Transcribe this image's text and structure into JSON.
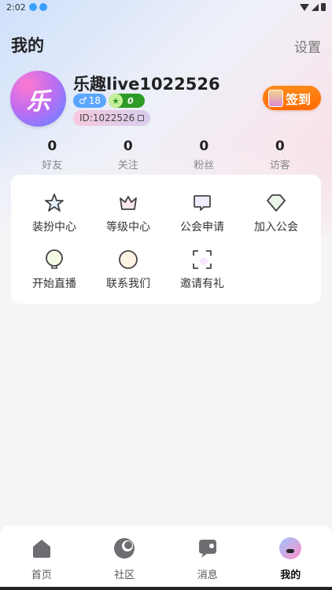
{
  "status_bar": {
    "time": "2:02"
  },
  "header": {
    "title": "我的",
    "settings_label": "设置"
  },
  "profile": {
    "avatar_text": "乐",
    "username": "乐趣live1022526",
    "gender_symbol": "♂",
    "age": "18",
    "level": "0",
    "id_text": "ID:1022526",
    "checkin_label": "签到"
  },
  "stats": [
    {
      "value": "0",
      "label": "好友"
    },
    {
      "value": "0",
      "label": "关注"
    },
    {
      "value": "0",
      "label": "粉丝"
    },
    {
      "value": "0",
      "label": "访客"
    }
  ],
  "menu": [
    {
      "label": "装扮中心",
      "icon": "star-icon"
    },
    {
      "label": "等级中心",
      "icon": "crown-icon"
    },
    {
      "label": "公会申请",
      "icon": "chat-bubble-icon"
    },
    {
      "label": "加入公会",
      "icon": "shield-icon"
    },
    {
      "label": "开始直播",
      "icon": "bulb-icon"
    },
    {
      "label": "联系我们",
      "icon": "contact-icon"
    },
    {
      "label": "邀请有礼",
      "icon": "scan-frame-icon"
    }
  ],
  "tabs": [
    {
      "label": "首页",
      "icon": "home-icon",
      "active": false
    },
    {
      "label": "社区",
      "icon": "moon-icon",
      "active": false
    },
    {
      "label": "消息",
      "icon": "message-icon",
      "active": false
    },
    {
      "label": "我的",
      "icon": "profile-icon",
      "active": true
    }
  ],
  "colors": {
    "checkin": "#ff6a00",
    "level_badge": "#2e9b26",
    "gender_badge": "#5aa6ff"
  }
}
